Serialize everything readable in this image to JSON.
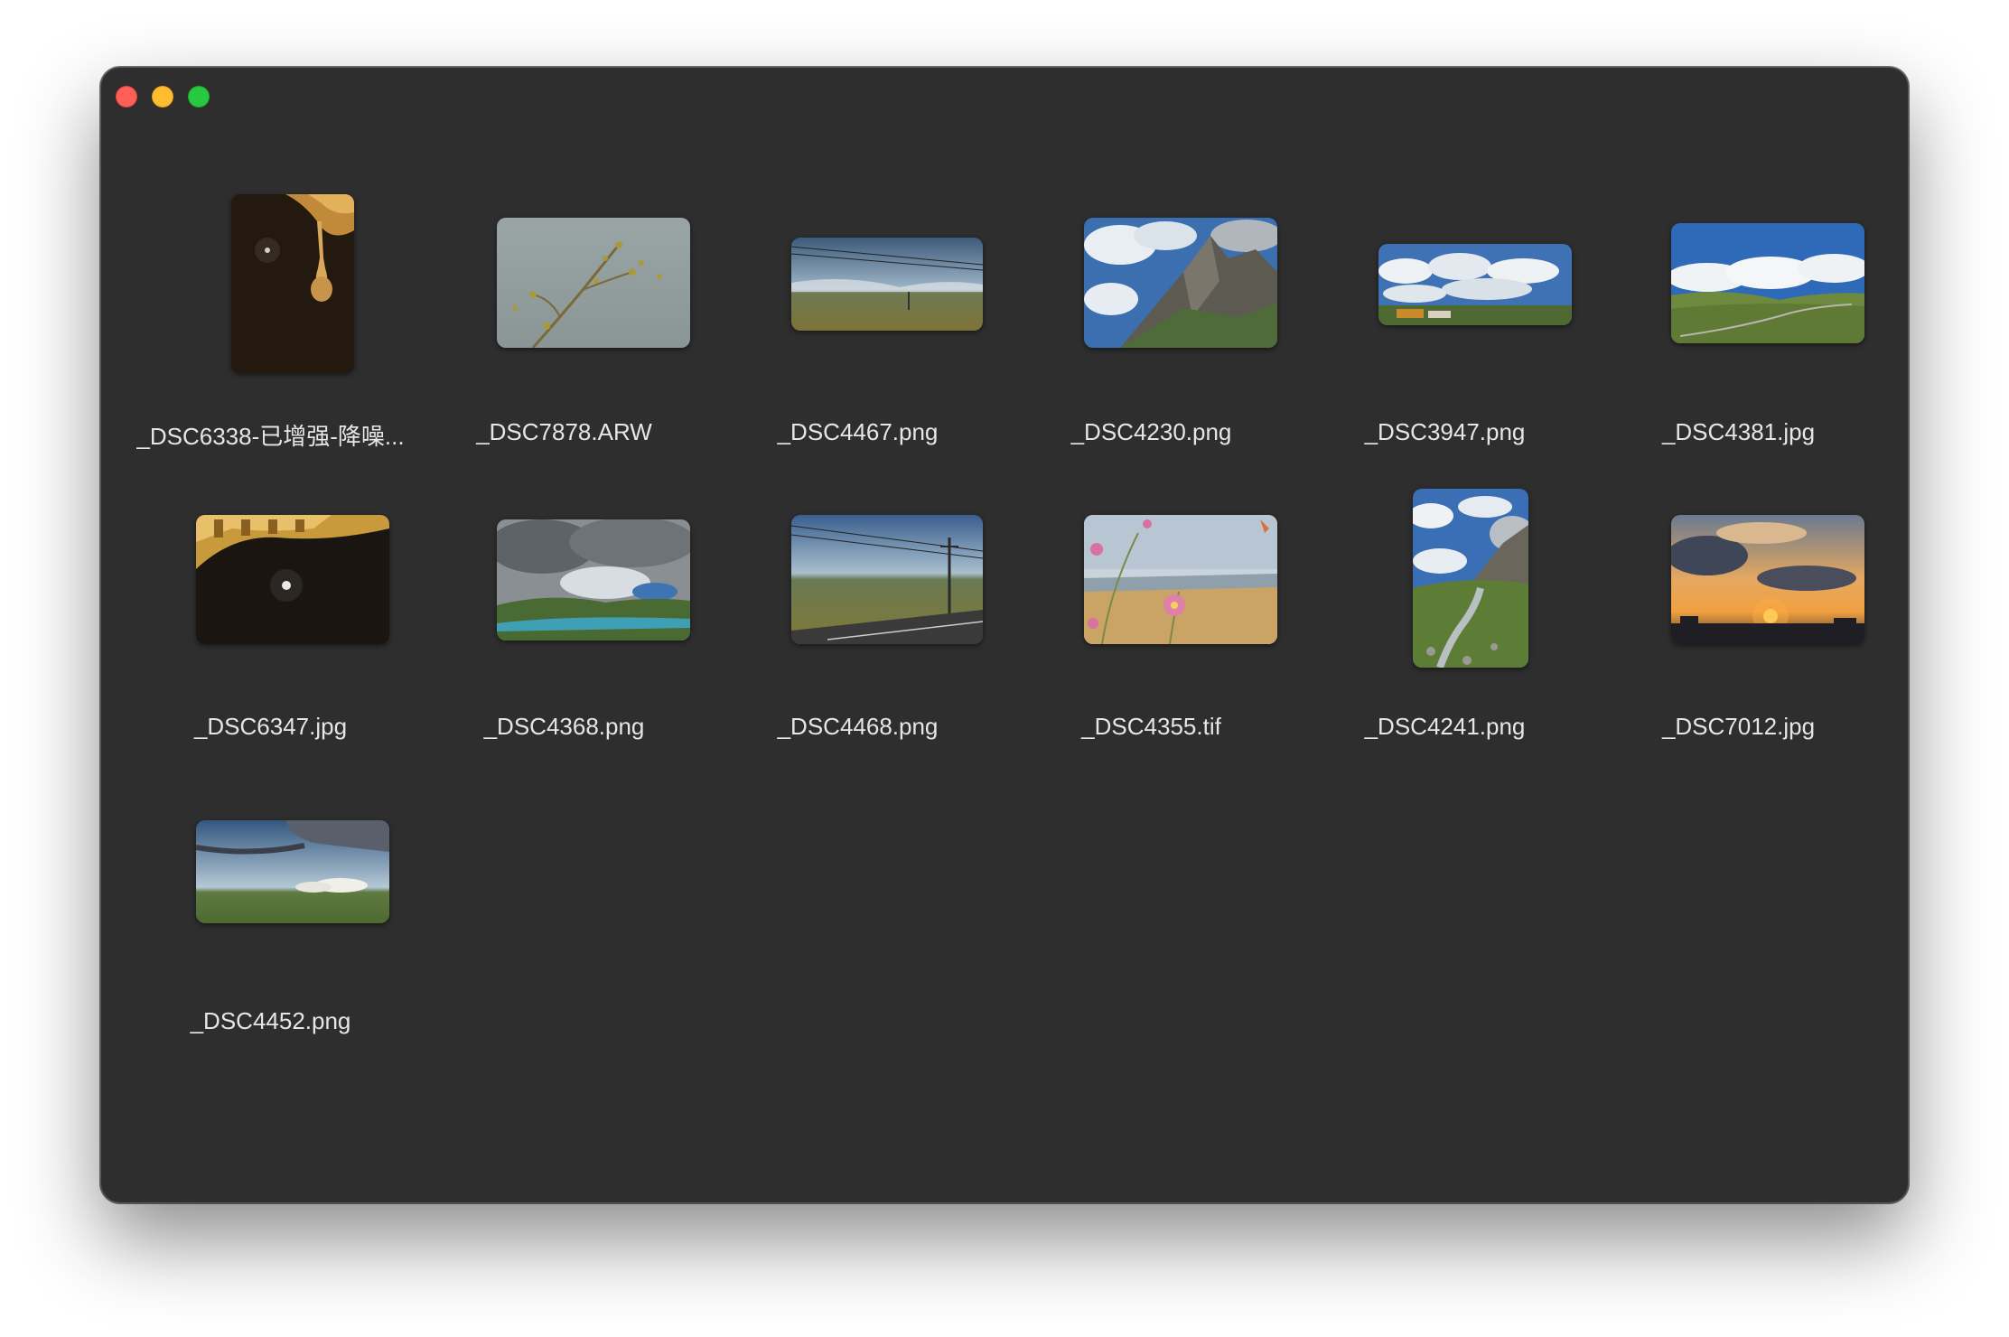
{
  "window": {
    "traffic_lights": [
      {
        "name": "close",
        "color": "#fe5f57"
      },
      {
        "name": "minimize",
        "color": "#febc2e"
      },
      {
        "name": "zoom",
        "color": "#28c840"
      }
    ],
    "background": "#2e2e2e"
  },
  "files": [
    {
      "label": "_DSC6338-已增强-降噪...",
      "orientation": "portrait",
      "scene": "night-ornament"
    },
    {
      "label": "_DSC7878.ARW",
      "orientation": "landscape",
      "scene": "branch-grey-sky"
    },
    {
      "label": "_DSC4467.png",
      "orientation": "wide",
      "scene": "grassland-power-lines"
    },
    {
      "label": "_DSC4230.png",
      "orientation": "landscape",
      "scene": "rocky-mountain-clouds"
    },
    {
      "label": "_DSC3947.png",
      "orientation": "wide",
      "scene": "cloudy-blue-sky"
    },
    {
      "label": "_DSC4381.jpg",
      "orientation": "landscape",
      "scene": "green-valley-road"
    },
    {
      "label": "_DSC6347.jpg",
      "orientation": "landscape",
      "scene": "night-moon-eaves"
    },
    {
      "label": "_DSC4368.png",
      "orientation": "landscape",
      "scene": "storm-clouds-lake"
    },
    {
      "label": "_DSC4468.png",
      "orientation": "landscape",
      "scene": "road-power-pole"
    },
    {
      "label": "_DSC4355.tif",
      "orientation": "landscape",
      "scene": "pink-flowers"
    },
    {
      "label": "_DSC4241.png",
      "orientation": "portrait",
      "scene": "mountain-stream"
    },
    {
      "label": "_DSC7012.jpg",
      "orientation": "landscape",
      "scene": "sunset"
    },
    {
      "label": "_DSC4452.png",
      "orientation": "wide",
      "scene": "grassland-clouds"
    }
  ]
}
